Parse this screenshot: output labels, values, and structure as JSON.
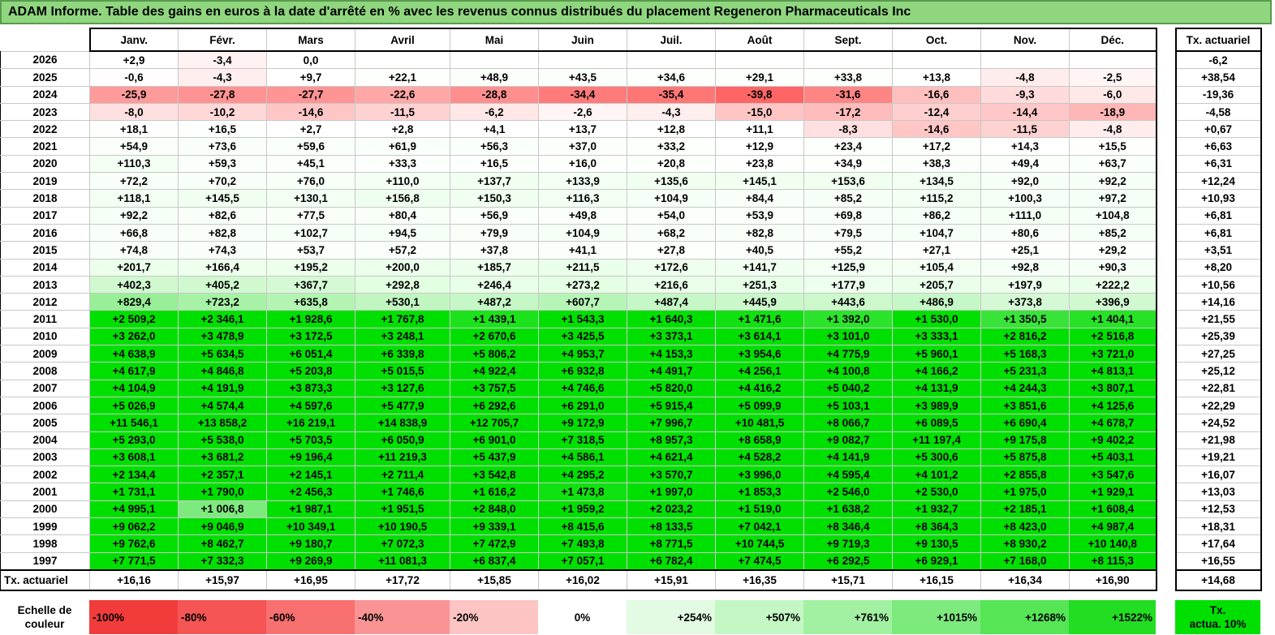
{
  "title": "ADAM Informe. Table des gains en euros à la date d'arrêté en % avec les revenus connus distribués du placement Regeneron Pharmaceuticals Inc",
  "months": [
    "Janv.",
    "Févr.",
    "Mars",
    "Avril",
    "Mai",
    "Juin",
    "Juil.",
    "Août",
    "Sept.",
    "Oct.",
    "Nov.",
    "Déc."
  ],
  "tx_header": "Tx. actuariel",
  "rows": [
    {
      "year": "2026",
      "values": [
        "+2,9",
        "-3,4",
        "0,0",
        "",
        "",
        "",
        "",
        "",
        "",
        "",
        "",
        ""
      ],
      "tx": "-6,2"
    },
    {
      "year": "2025",
      "values": [
        "-0,6",
        "-4,3",
        "+9,7",
        "+22,1",
        "+48,9",
        "+43,5",
        "+34,6",
        "+29,1",
        "+33,8",
        "+13,8",
        "-4,8",
        "-2,5"
      ],
      "tx": "+38,54"
    },
    {
      "year": "2024",
      "values": [
        "-25,9",
        "-27,8",
        "-27,7",
        "-22,6",
        "-28,8",
        "-34,4",
        "-35,4",
        "-39,8",
        "-31,6",
        "-16,6",
        "-9,3",
        "-6,0"
      ],
      "tx": "-19,36"
    },
    {
      "year": "2023",
      "values": [
        "-8,0",
        "-10,2",
        "-14,6",
        "-11,5",
        "-6,2",
        "-2,6",
        "-4,3",
        "-15,0",
        "-17,2",
        "-12,4",
        "-14,4",
        "-18,9"
      ],
      "tx": "-4,58"
    },
    {
      "year": "2022",
      "values": [
        "+18,1",
        "+16,5",
        "+2,7",
        "+2,8",
        "+4,1",
        "+13,7",
        "+12,8",
        "+11,1",
        "-8,3",
        "-14,6",
        "-11,5",
        "-4,8"
      ],
      "tx": "+0,67"
    },
    {
      "year": "2021",
      "values": [
        "+54,9",
        "+73,6",
        "+59,6",
        "+61,9",
        "+56,3",
        "+37,0",
        "+33,2",
        "+12,9",
        "+23,4",
        "+17,2",
        "+14,3",
        "+15,5"
      ],
      "tx": "+6,63"
    },
    {
      "year": "2020",
      "values": [
        "+110,3",
        "+59,3",
        "+45,1",
        "+33,3",
        "+16,5",
        "+16,0",
        "+20,8",
        "+23,8",
        "+34,9",
        "+38,3",
        "+49,4",
        "+63,7"
      ],
      "tx": "+6,31"
    },
    {
      "year": "2019",
      "values": [
        "+72,2",
        "+70,2",
        "+76,0",
        "+110,0",
        "+137,7",
        "+133,9",
        "+135,6",
        "+145,1",
        "+153,6",
        "+134,5",
        "+92,0",
        "+92,2"
      ],
      "tx": "+12,24"
    },
    {
      "year": "2018",
      "values": [
        "+118,1",
        "+145,5",
        "+130,1",
        "+156,8",
        "+150,3",
        "+116,3",
        "+104,9",
        "+84,4",
        "+85,2",
        "+115,2",
        "+100,3",
        "+97,2"
      ],
      "tx": "+10,93"
    },
    {
      "year": "2017",
      "values": [
        "+92,2",
        "+82,6",
        "+77,5",
        "+80,4",
        "+56,9",
        "+49,8",
        "+54,0",
        "+53,9",
        "+69,8",
        "+86,2",
        "+111,0",
        "+104,8"
      ],
      "tx": "+6,81"
    },
    {
      "year": "2016",
      "values": [
        "+66,8",
        "+82,8",
        "+102,7",
        "+94,5",
        "+79,9",
        "+104,9",
        "+68,2",
        "+82,8",
        "+79,5",
        "+104,7",
        "+80,6",
        "+85,2"
      ],
      "tx": "+6,81"
    },
    {
      "year": "2015",
      "values": [
        "+74,8",
        "+74,3",
        "+53,7",
        "+57,2",
        "+37,8",
        "+41,1",
        "+27,8",
        "+40,5",
        "+55,2",
        "+27,1",
        "+25,1",
        "+29,2"
      ],
      "tx": "+3,51"
    },
    {
      "year": "2014",
      "values": [
        "+201,7",
        "+166,4",
        "+195,2",
        "+200,0",
        "+185,7",
        "+211,5",
        "+172,6",
        "+141,7",
        "+125,9",
        "+105,4",
        "+92,8",
        "+90,3"
      ],
      "tx": "+8,20"
    },
    {
      "year": "2013",
      "values": [
        "+402,3",
        "+405,2",
        "+367,7",
        "+292,8",
        "+246,4",
        "+273,2",
        "+216,6",
        "+251,3",
        "+177,9",
        "+205,7",
        "+197,9",
        "+222,2"
      ],
      "tx": "+10,56"
    },
    {
      "year": "2012",
      "values": [
        "+829,4",
        "+723,2",
        "+635,8",
        "+530,1",
        "+487,2",
        "+607,7",
        "+487,4",
        "+445,9",
        "+443,6",
        "+486,9",
        "+373,8",
        "+396,9"
      ],
      "tx": "+14,16"
    },
    {
      "year": "2011",
      "values": [
        "+2 509,2",
        "+2 346,1",
        "+1 928,6",
        "+1 767,8",
        "+1 439,1",
        "+1 543,3",
        "+1 640,3",
        "+1 471,6",
        "+1 392,0",
        "+1 530,0",
        "+1 350,5",
        "+1 404,1"
      ],
      "tx": "+21,55"
    },
    {
      "year": "2010",
      "values": [
        "+3 262,0",
        "+3 478,9",
        "+3 172,5",
        "+3 248,1",
        "+2 670,6",
        "+3 425,5",
        "+3 373,1",
        "+3 614,1",
        "+3 101,0",
        "+3 333,1",
        "+2 816,2",
        "+2 516,8"
      ],
      "tx": "+25,39"
    },
    {
      "year": "2009",
      "values": [
        "+4 638,9",
        "+5 634,5",
        "+6 051,4",
        "+6 339,8",
        "+5 806,2",
        "+4 953,7",
        "+4 153,3",
        "+3 954,6",
        "+4 775,9",
        "+5 960,1",
        "+5 168,3",
        "+3 721,0"
      ],
      "tx": "+27,25"
    },
    {
      "year": "2008",
      "values": [
        "+4 617,9",
        "+4 846,8",
        "+5 203,8",
        "+5 015,5",
        "+4 922,4",
        "+6 932,8",
        "+4 491,7",
        "+4 256,1",
        "+4 100,8",
        "+4 166,2",
        "+5 231,3",
        "+4 813,1"
      ],
      "tx": "+25,12"
    },
    {
      "year": "2007",
      "values": [
        "+4 104,9",
        "+4 191,9",
        "+3 873,3",
        "+3 127,6",
        "+3 757,5",
        "+4 746,6",
        "+5 820,0",
        "+4 416,2",
        "+5 040,2",
        "+4 131,9",
        "+4 244,3",
        "+3 807,1"
      ],
      "tx": "+22,81"
    },
    {
      "year": "2006",
      "values": [
        "+5 026,9",
        "+4 574,4",
        "+4 597,6",
        "+5 477,9",
        "+6 292,6",
        "+6 291,0",
        "+5 915,4",
        "+5 099,9",
        "+5 103,1",
        "+3 989,9",
        "+3 851,6",
        "+4 125,6"
      ],
      "tx": "+22,29"
    },
    {
      "year": "2005",
      "values": [
        "+11 546,1",
        "+13 858,2",
        "+16 219,1",
        "+14 838,9",
        "+12 705,7",
        "+9 172,9",
        "+7 996,7",
        "+10 481,5",
        "+8 066,7",
        "+6 089,5",
        "+6 690,4",
        "+4 678,7"
      ],
      "tx": "+24,52"
    },
    {
      "year": "2004",
      "values": [
        "+5 293,0",
        "+5 538,0",
        "+5 703,5",
        "+6 050,9",
        "+6 901,0",
        "+7 318,5",
        "+8 957,3",
        "+8 658,9",
        "+9 082,7",
        "+11 197,4",
        "+9 175,8",
        "+9 402,2"
      ],
      "tx": "+21,98"
    },
    {
      "year": "2003",
      "values": [
        "+3 608,1",
        "+3 681,2",
        "+9 196,4",
        "+11 219,3",
        "+5 437,9",
        "+4 586,1",
        "+4 621,4",
        "+4 528,2",
        "+4 141,9",
        "+5 300,6",
        "+5 875,8",
        "+5 403,1"
      ],
      "tx": "+19,21"
    },
    {
      "year": "2002",
      "values": [
        "+2 134,4",
        "+2 357,1",
        "+2 145,1",
        "+2 711,4",
        "+3 542,8",
        "+4 295,2",
        "+3 570,7",
        "+3 996,0",
        "+4 595,4",
        "+4 101,2",
        "+2 855,8",
        "+3 547,6"
      ],
      "tx": "+16,07"
    },
    {
      "year": "2001",
      "values": [
        "+1 731,1",
        "+1 790,0",
        "+2 456,3",
        "+1 746,6",
        "+1 616,2",
        "+1 473,8",
        "+1 997,0",
        "+1 853,3",
        "+2 546,0",
        "+2 530,0",
        "+1 975,0",
        "+1 929,1"
      ],
      "tx": "+13,03"
    },
    {
      "year": "2000",
      "values": [
        "+4 995,1",
        "+1 006,8",
        "+1 987,1",
        "+1 951,5",
        "+2 848,0",
        "+1 959,2",
        "+2 023,2",
        "+1 519,0",
        "+1 638,2",
        "+1 932,7",
        "+2 185,1",
        "+1 608,4"
      ],
      "tx": "+12,53"
    },
    {
      "year": "1999",
      "values": [
        "+9 062,2",
        "+9 046,9",
        "+10 349,1",
        "+10 190,5",
        "+9 339,1",
        "+8 415,6",
        "+8 133,5",
        "+7 042,1",
        "+8 346,4",
        "+8 364,3",
        "+8 423,0",
        "+4 987,4"
      ],
      "tx": "+18,31"
    },
    {
      "year": "1998",
      "values": [
        "+9 762,6",
        "+8 462,7",
        "+9 180,7",
        "+7 072,3",
        "+7 472,9",
        "+7 493,8",
        "+8 771,5",
        "+10 744,5",
        "+9 719,3",
        "+9 130,5",
        "+8 930,2",
        "+10 140,8"
      ],
      "tx": "+17,64"
    },
    {
      "year": "1997",
      "values": [
        "+7 771,5",
        "+7 332,3",
        "+9 269,9",
        "+11 081,3",
        "+6 837,4",
        "+7 057,1",
        "+6 782,4",
        "+7 474,5",
        "+6 292,5",
        "+6 929,1",
        "+7 168,0",
        "+8 115,3"
      ],
      "tx": "+16,55"
    }
  ],
  "total": {
    "label": "Tx. actuariel",
    "values": [
      "+16,16",
      "+15,97",
      "+16,95",
      "+17,72",
      "+15,85",
      "+16,02",
      "+15,91",
      "+16,35",
      "+15,71",
      "+16,15",
      "+16,34",
      "+16,90"
    ],
    "tx": "+14,68"
  },
  "scale": {
    "label_line1": "Echelle de",
    "label_line2": "couleur",
    "items": [
      "-100%",
      "-80%",
      "-60%",
      "-40%",
      "-20%",
      "0%",
      "+254%",
      "+507%",
      "+761%",
      "+1015%",
      "+1268%",
      "+1522%"
    ],
    "actua_line1": "Tx.",
    "actua_line2": "actua. 10%"
  },
  "colors": {
    "title_bg": "#8fd67f",
    "scale": [
      "#f23c3c",
      "#f55555",
      "#f87070",
      "#fa9494",
      "#fdc4c4",
      "#ffffff",
      "#e2fbe2",
      "#c4f7c4",
      "#a2f1a2",
      "#7cea7c",
      "#55e555",
      "#22dd22"
    ],
    "actua": "#00e000"
  }
}
